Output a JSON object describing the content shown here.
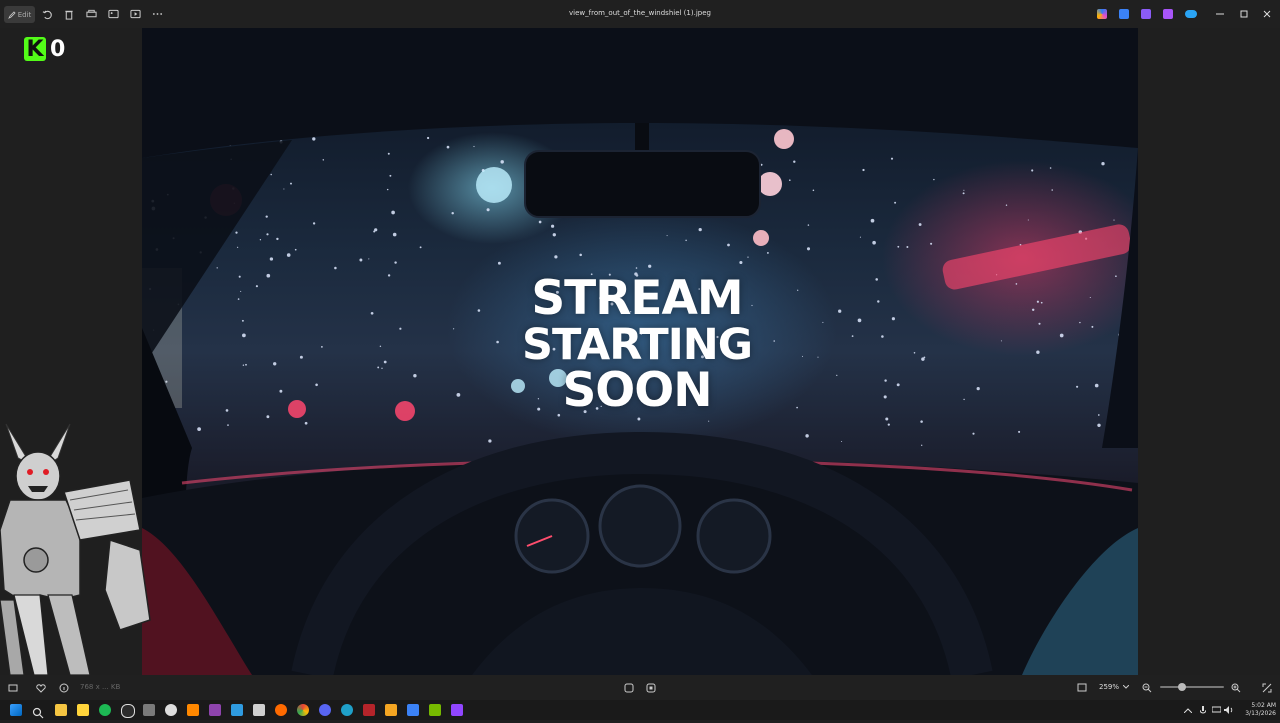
{
  "window": {
    "title": "view_from_out_of_the_windshiel (1).jpeg",
    "toolbar": {
      "edit_label": "Edit",
      "icons": [
        "edit-icon",
        "rotate-icon",
        "delete-icon",
        "print-icon",
        "crop-icon",
        "slideshow-icon",
        "more-icon"
      ]
    },
    "extensions": [
      "copilot-icon",
      "photos-edit-icon",
      "clipchamp-icon",
      "designer-icon",
      "onedrive-icon"
    ],
    "controls": [
      "minimize-icon",
      "maximize-icon",
      "close-icon"
    ]
  },
  "overlay": {
    "counter_logo": "K",
    "counter_value": "0",
    "accent": "#53fc18"
  },
  "image": {
    "headline_lines": [
      "STREAM",
      "STARTING",
      "SOON"
    ]
  },
  "status_bar": {
    "file_info": "768 x ... KB",
    "zoom_value": "259%",
    "zoom_level": 0.35
  },
  "taskbar": {
    "apps": [
      "windows-start",
      "search",
      "file-explorer",
      "notes",
      "music-app",
      "obs",
      "unity",
      "vlc",
      "steam",
      "visual-studio",
      "photos",
      "notepad",
      "firefox",
      "chrome",
      "discord",
      "edge",
      "filezilla",
      "store",
      "settings",
      "nvidia",
      "twitch"
    ],
    "time": "5:02 AM",
    "date": "3/13/2026"
  }
}
